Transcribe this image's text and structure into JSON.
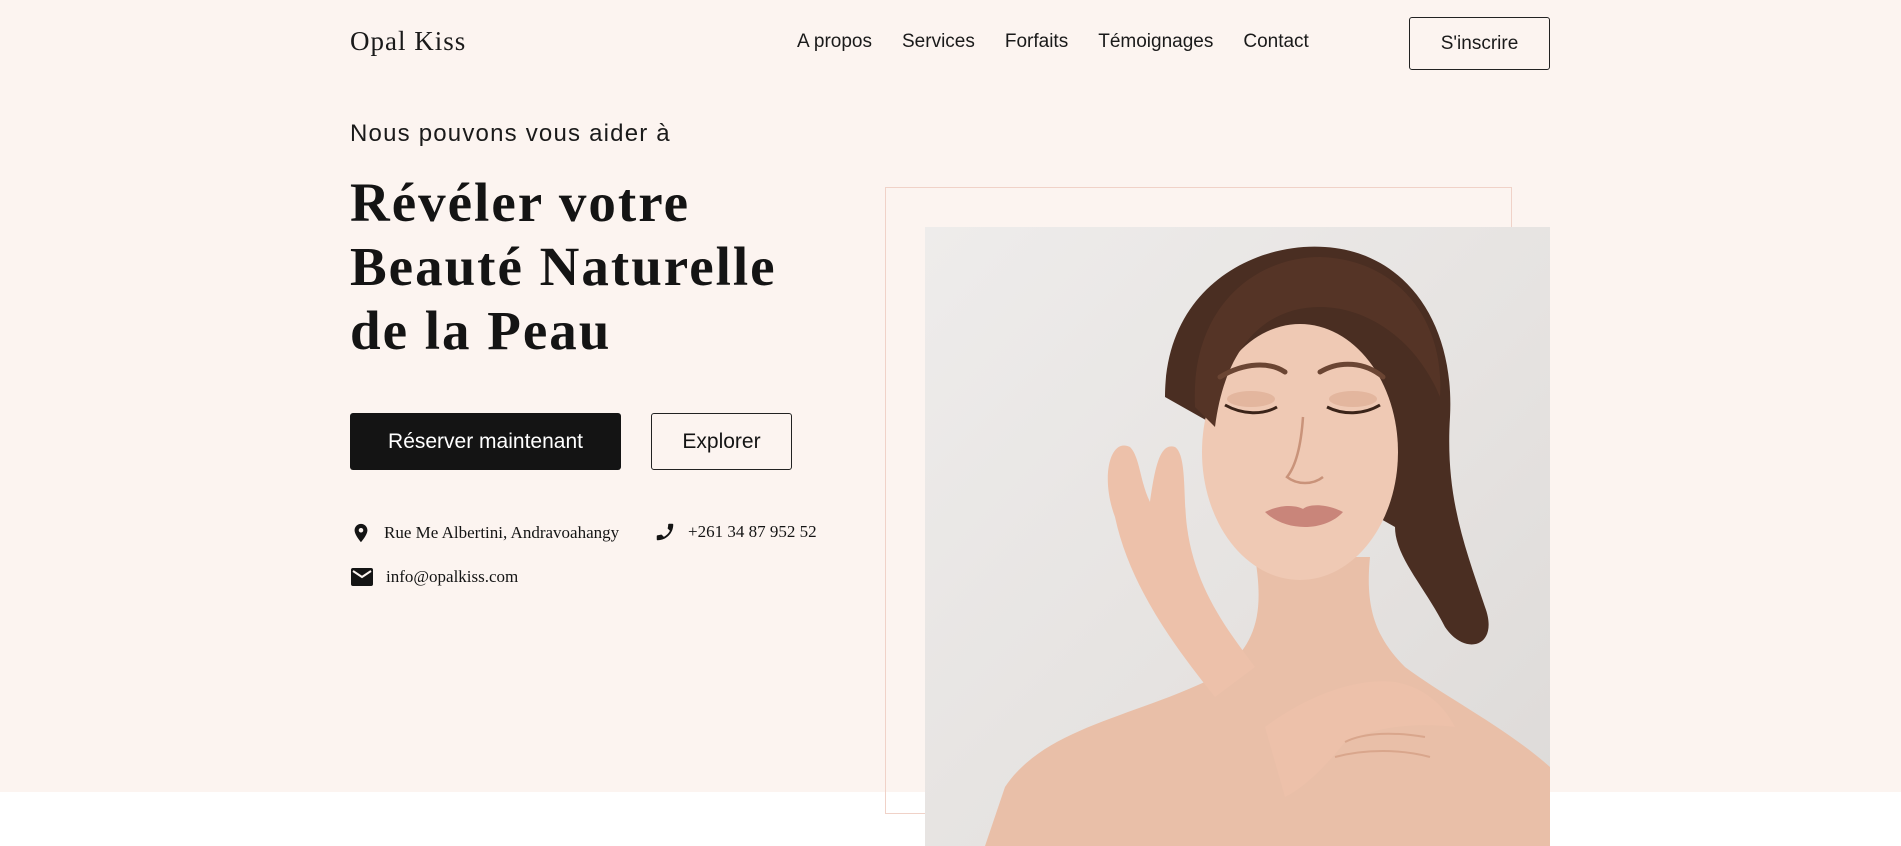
{
  "brand": {
    "name": "Opal Kiss"
  },
  "nav": {
    "items": [
      {
        "label": "A propos"
      },
      {
        "label": "Services"
      },
      {
        "label": "Forfaits"
      },
      {
        "label": "Témoignages"
      },
      {
        "label": "Contact"
      }
    ],
    "signup_label": "S'inscrire"
  },
  "hero": {
    "eyebrow": "Nous pouvons vous aider à",
    "headline_lines": [
      "Révéler votre",
      "Beauté Naturelle",
      "de la Peau"
    ],
    "primary_cta": "Réserver maintenant",
    "secondary_cta": "Explorer"
  },
  "contact": {
    "address": "Rue Me Albertini, Andravoahangy",
    "phone": "+261 34 87 952 52",
    "email": "info@opalkiss.com"
  },
  "icons": {
    "address": "location-pin-icon",
    "phone": "phone-icon",
    "email": "envelope-icon"
  },
  "colors": {
    "hero_background": "#fcf4f0",
    "primary_button": "#141414",
    "frame_border": "#f0d2c8"
  }
}
